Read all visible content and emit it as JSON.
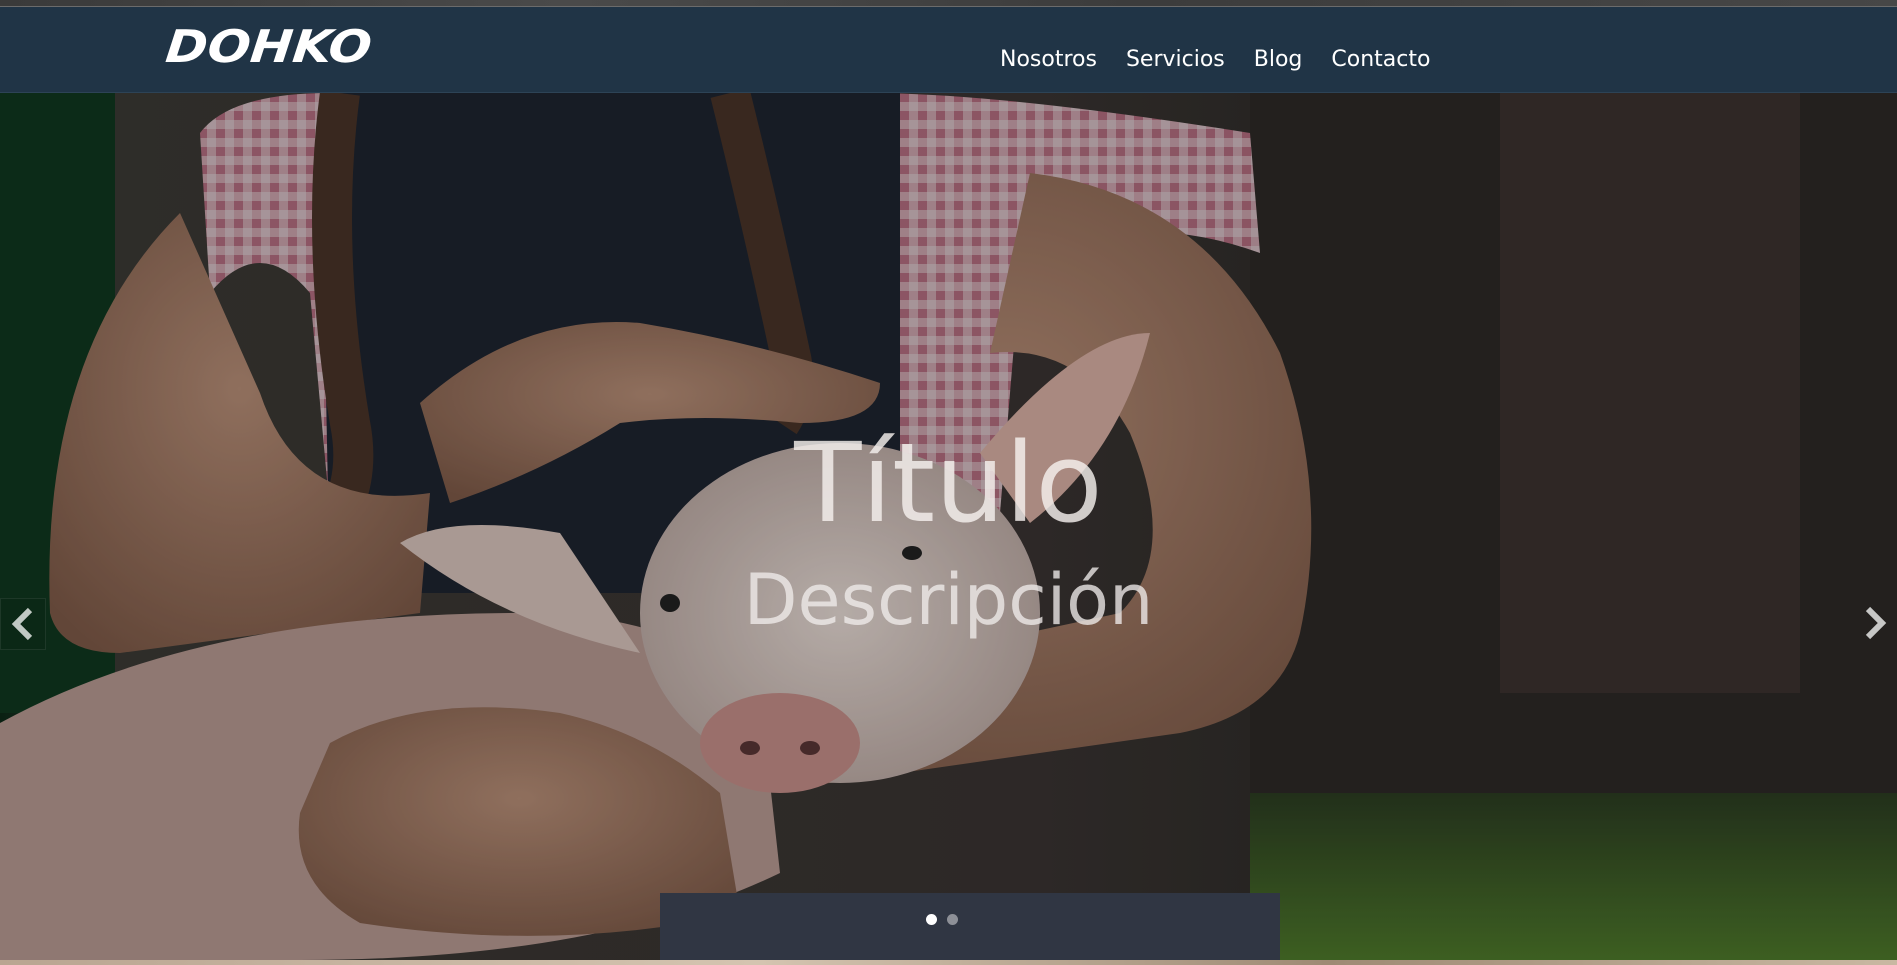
{
  "brand": {
    "logo_text": "DOHKO"
  },
  "nav": {
    "items": [
      {
        "label": "Nosotros"
      },
      {
        "label": "Servicios"
      },
      {
        "label": "Blog"
      },
      {
        "label": "Contacto"
      }
    ]
  },
  "hero": {
    "title": "Título",
    "description": "Descripción",
    "prev_icon": "chevron-left-icon",
    "next_icon": "chevron-right-icon",
    "slides_count": 2,
    "active_slide": 1
  },
  "colors": {
    "navbar": "#203446",
    "text": "#ffffff"
  }
}
